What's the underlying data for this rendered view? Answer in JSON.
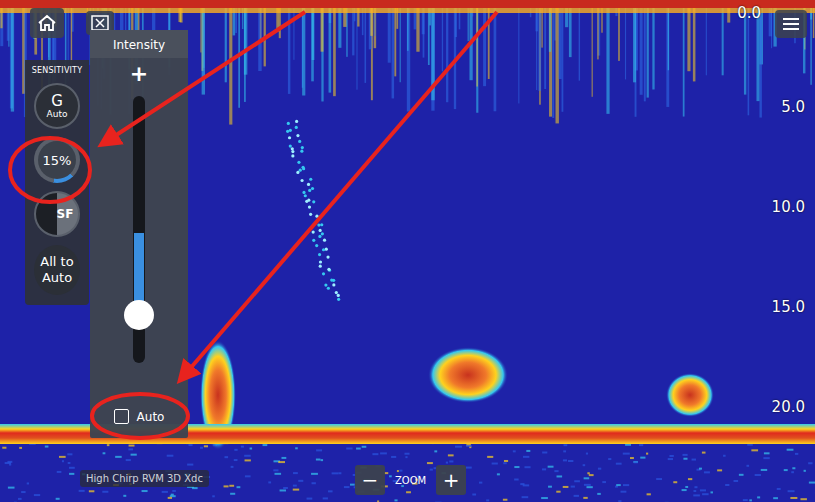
{
  "sidebar": {
    "title": "SENSITIVITY",
    "buttons": [
      {
        "label": "G",
        "sub": "Auto",
        "kind": "gain",
        "selected": false,
        "level": 0
      },
      {
        "label": "15%",
        "sub": "",
        "kind": "intensity",
        "selected": true,
        "level": 0.15
      },
      {
        "label": "SF",
        "sub": "",
        "kind": "surface",
        "selected": false,
        "level": 0.5
      },
      {
        "label": "All to Auto",
        "sub": "",
        "kind": "reset",
        "selected": false,
        "level": 0
      }
    ]
  },
  "intensity_panel": {
    "title": "Intensity",
    "plus": "+",
    "level": 0.18,
    "auto": {
      "label": "Auto",
      "checked": false
    }
  },
  "depth_scale": [
    "0.0",
    "5.0",
    "10.0",
    "15.0",
    "20.0"
  ],
  "transducer": "High Chirp RVM 3D Xdc",
  "zoom": {
    "minus": "−",
    "label": "ZOOM",
    "plus": "+"
  }
}
